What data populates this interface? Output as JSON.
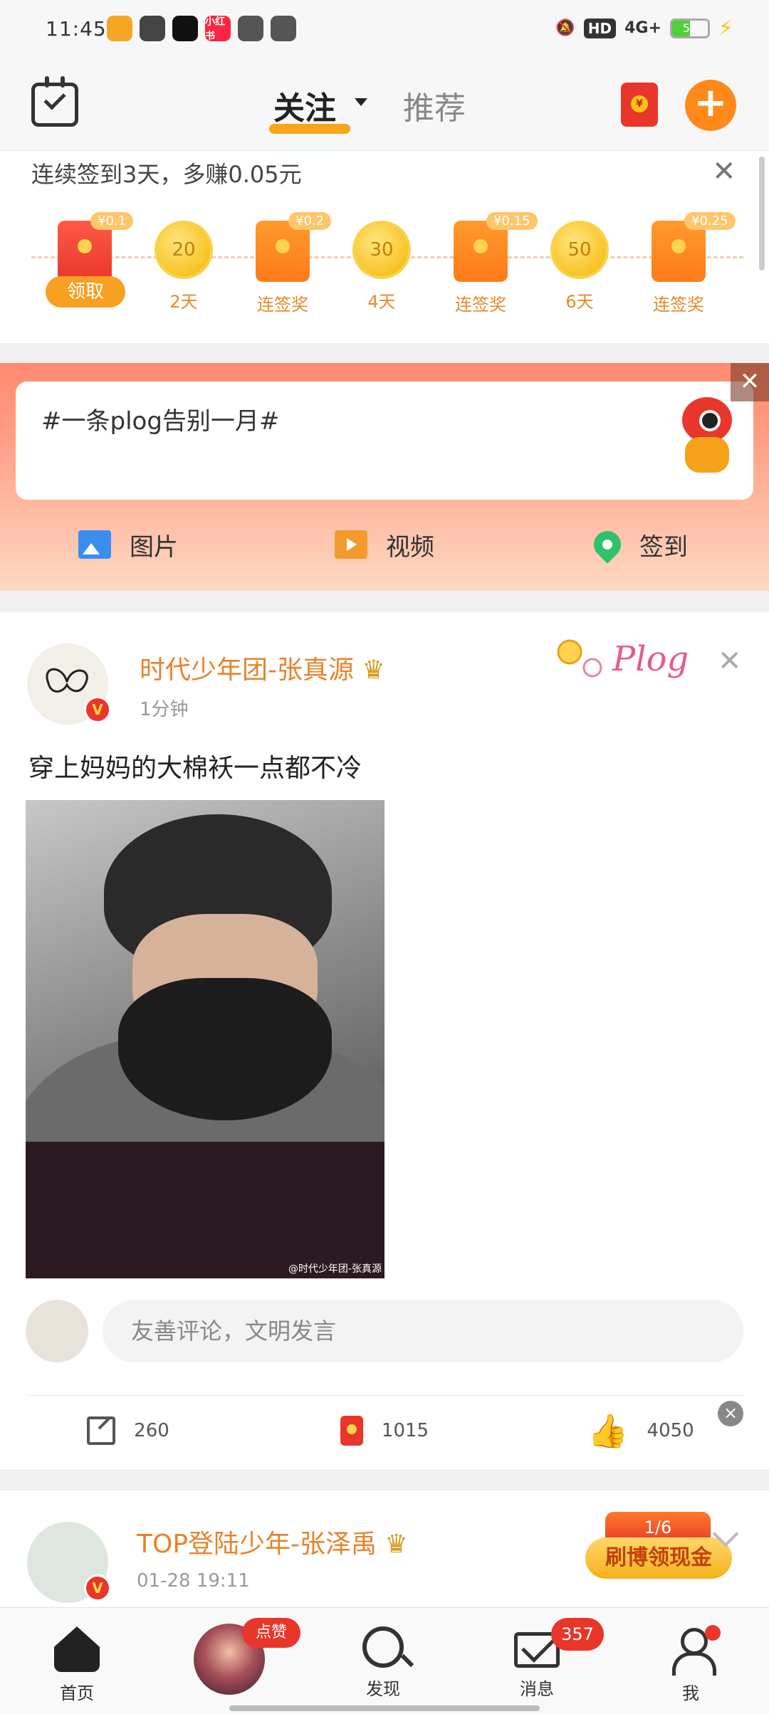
{
  "status_bar": {
    "time": "11:45",
    "apps": [
      {
        "icon": "weibo-app-icon",
        "label": "",
        "color": "#f5a623"
      },
      {
        "icon": "link-app-icon",
        "label": "",
        "color": "#444444"
      },
      {
        "icon": "tiktok-app-icon",
        "label": "",
        "color": "#111111"
      },
      {
        "icon": "xiaohongshu-app-icon",
        "label": "小红书",
        "color": "#ff2442"
      },
      {
        "icon": "pinwheel-app-icon",
        "label": "",
        "color": "#555555"
      },
      {
        "icon": "play-app-icon",
        "label": "",
        "color": "#555555"
      }
    ],
    "hd": "HD",
    "network": "4G+",
    "battery": "50",
    "battery_level": 50
  },
  "header": {
    "tab_follow": "关注",
    "tab_recommend": "推荐"
  },
  "signin": {
    "title": "连续签到3天，多赚0.05元",
    "claim_label": "领取",
    "items": [
      {
        "kind": "packet",
        "amount": "¥0.1",
        "label": ""
      },
      {
        "kind": "coin",
        "value": "20",
        "label": "2天"
      },
      {
        "kind": "packet",
        "amount": "¥0.2",
        "label": "连签奖"
      },
      {
        "kind": "coin",
        "value": "30",
        "label": "4天"
      },
      {
        "kind": "packet",
        "amount": "¥0.15",
        "label": "连签奖"
      },
      {
        "kind": "coin",
        "value": "50",
        "label": "6天"
      },
      {
        "kind": "packet",
        "amount": "¥0.25",
        "label": "连签奖"
      }
    ]
  },
  "composer": {
    "topic": "#一条plog告别一月#",
    "actions": [
      {
        "icon": "image-icon",
        "label": "图片"
      },
      {
        "icon": "video-icon",
        "label": "视频"
      },
      {
        "icon": "location-pin-icon",
        "label": "签到"
      }
    ]
  },
  "posts": [
    {
      "author": "时代少年团-张真源",
      "time": "1分钟",
      "text": "穿上妈妈的大棉袄一点都不冷",
      "badge": "Plog",
      "watermark": "@时代少年团-张真源",
      "comment_placeholder": "友善评论，文明发言",
      "shares": "260",
      "rewards": "1015",
      "likes": "4050"
    },
    {
      "author": "TOP登陆少年-张泽禹",
      "time": "01-28 19:11"
    }
  ],
  "promo": {
    "progress": "1/6",
    "label": "刷博领现金"
  },
  "tabbar": {
    "items": [
      {
        "label": "首页"
      },
      {
        "label": ""
      },
      {
        "label": "发现"
      },
      {
        "label": "消息"
      },
      {
        "label": "我"
      }
    ],
    "like_pill": "点赞",
    "message_badge": "357"
  },
  "colors": {
    "accent": "#ff8a1a",
    "author": "#e8822a",
    "red": "#e8362b"
  }
}
